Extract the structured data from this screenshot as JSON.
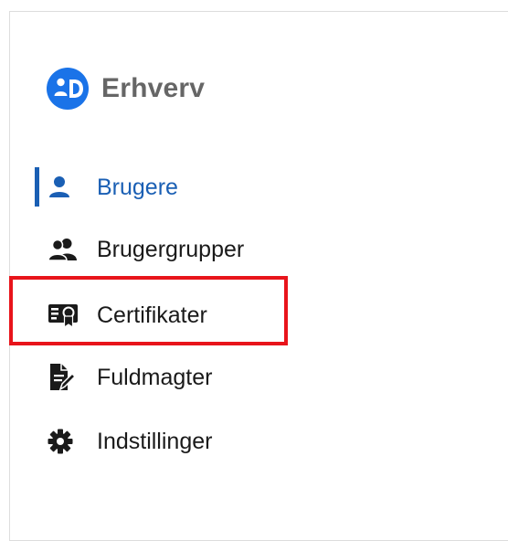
{
  "brand": {
    "name": "Erhverv",
    "logo_icon": "mitid-erhverv-logo",
    "accent_color": "#1a73e8"
  },
  "nav": {
    "active_color": "#1a5fb4",
    "highlight_color": "#e8141b",
    "items": [
      {
        "label": "Brugere",
        "icon": "user-icon",
        "active": true
      },
      {
        "label": "Brugergrupper",
        "icon": "users-icon",
        "active": false
      },
      {
        "label": "Certifikater",
        "icon": "certificate-icon",
        "active": false,
        "highlighted": true
      },
      {
        "label": "Fuldmagter",
        "icon": "signed-document-icon",
        "active": false
      },
      {
        "label": "Indstillinger",
        "icon": "gear-icon",
        "active": false
      }
    ]
  }
}
